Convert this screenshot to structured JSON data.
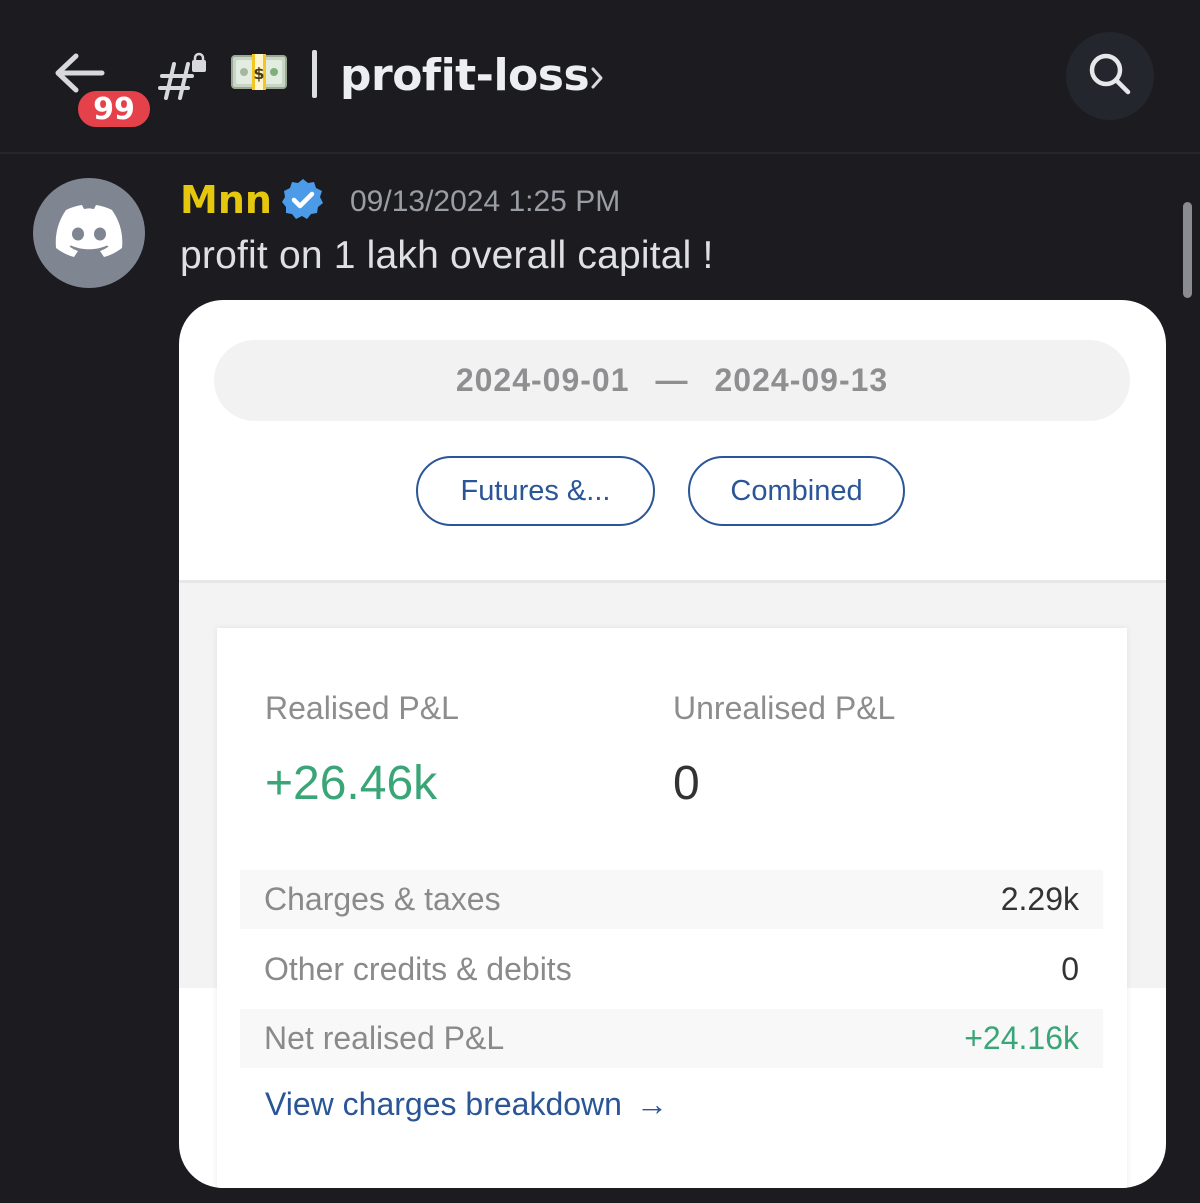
{
  "header": {
    "back_icon": "arrow-left-icon",
    "unread_badge": "99",
    "channel_icon": "locked-hashtag-icon",
    "channel_emoji": "money-with-wings-banknote-icon",
    "channel_name": "profit-loss",
    "chevron_icon": "chevron-right-icon",
    "search_icon": "search-icon"
  },
  "message": {
    "avatar_icon": "discord-logo-icon",
    "username": "Mnn",
    "username_color": "#e5c70e",
    "verified_icon": "verified-badge-icon",
    "timestamp": "09/13/2024 1:25 PM",
    "text": "profit on 1 lakh overall capital !"
  },
  "attachment": {
    "date_range": {
      "from": "2024-09-01",
      "separator": "—",
      "to": "2024-09-13"
    },
    "filters": [
      {
        "label": "Futures &..."
      },
      {
        "label": "Combined"
      }
    ],
    "summary": {
      "realised_label": "Realised P&L",
      "realised_value": "+26.46k",
      "unrealised_label": "Unrealised P&L",
      "unrealised_value": "0",
      "rows": [
        {
          "label": "Charges & taxes",
          "value": "2.29k"
        },
        {
          "label": "Other credits & debits",
          "value": "0"
        },
        {
          "label": "Net realised P&L",
          "value": "+24.16k"
        }
      ],
      "breakdown_link": "View charges breakdown",
      "breakdown_arrow": "→"
    },
    "colors": {
      "positive": "#3aa678",
      "link": "#2a5596"
    }
  }
}
